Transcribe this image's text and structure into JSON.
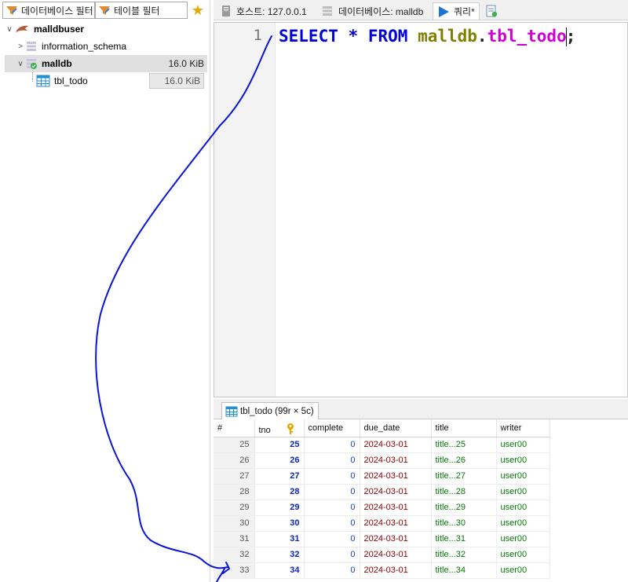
{
  "filters": {
    "db_filter": "데이터베이스 필터",
    "table_filter": "테이블 필터"
  },
  "tree": {
    "session": "malldbuser",
    "databases": [
      {
        "name": "information_schema",
        "size": ""
      },
      {
        "name": "malldb",
        "size": "16.0 KiB"
      }
    ],
    "tables": [
      {
        "name": "tbl_todo",
        "size": "16.0 KiB"
      }
    ]
  },
  "tabs": {
    "host": "호스트: 127.0.0.1",
    "database": "데이터베이스: malldb",
    "query": "쿼리*"
  },
  "editor": {
    "line_number": "1",
    "tokens": {
      "select": "SELECT",
      "star": "*",
      "from": "FROM",
      "db": "malldb",
      "dot": ".",
      "table": "tbl_todo",
      "semi": ";"
    }
  },
  "result_tab": "tbl_todo (99r × 5c)",
  "grid": {
    "columns": [
      "#",
      "tno",
      "complete",
      "due_date",
      "title",
      "writer"
    ],
    "rows": [
      [
        "25",
        "25",
        "0",
        "2024-03-01",
        "title...25",
        "user00"
      ],
      [
        "26",
        "26",
        "0",
        "2024-03-01",
        "title...26",
        "user00"
      ],
      [
        "27",
        "27",
        "0",
        "2024-03-01",
        "title...27",
        "user00"
      ],
      [
        "28",
        "28",
        "0",
        "2024-03-01",
        "title...28",
        "user00"
      ],
      [
        "29",
        "29",
        "0",
        "2024-03-01",
        "title...29",
        "user00"
      ],
      [
        "30",
        "30",
        "0",
        "2024-03-01",
        "title...30",
        "user00"
      ],
      [
        "31",
        "31",
        "0",
        "2024-03-01",
        "title...31",
        "user00"
      ],
      [
        "32",
        "32",
        "0",
        "2024-03-01",
        "title...32",
        "user00"
      ],
      [
        "33",
        "34",
        "0",
        "2024-03-01",
        "title...34",
        "user00"
      ]
    ]
  },
  "colors": {
    "keyword": "#0000d8",
    "database": "#7f7f00",
    "table": "#d000d0",
    "annotation": "#0a14d8"
  }
}
